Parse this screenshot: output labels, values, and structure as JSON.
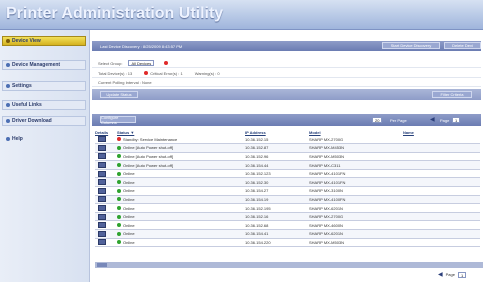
{
  "app": {
    "title": "Printer Administration Utility"
  },
  "sidebar": {
    "items": [
      {
        "label": "Device View",
        "active": true
      },
      {
        "label": "Device Management"
      },
      {
        "label": "Settings"
      },
      {
        "label": "Useful Links"
      },
      {
        "label": "Driver Download"
      },
      {
        "label": "Help"
      }
    ]
  },
  "header": {
    "last_discovery": "Last Device Discovery : 8/25/2009 8:43:57 PM",
    "start_discovery_button": "Start Device Discovery",
    "delete_button": "Delete Devi"
  },
  "group": {
    "label": "Select Group:",
    "value": "All Devices",
    "total_devices": "Total Device(s) : 13",
    "critical_errors": "Critical Error(s) : 1",
    "warnings": "Warning(s) : 0",
    "polling_interval": "Current Polling Interval : None"
  },
  "toolbar": {
    "update_status": "Update Status",
    "filter_criteria": "Filter Criteria",
    "configure_columns": "Configure Columns",
    "per_page_value": "20",
    "per_page_label": "Per Page",
    "page_label": "Page",
    "page_value": "1"
  },
  "table": {
    "headers": {
      "details": "Details",
      "status": "Status ▼",
      "ip": "IP Address",
      "model": "Model",
      "name": "Name"
    },
    "rows": [
      {
        "status": "Standby: Service Maintenance",
        "state": "error",
        "ip": "10.36.152.15",
        "model": "SHARP MX-2700G"
      },
      {
        "status": "Online [Auto Power shut-off]",
        "state": "ok",
        "ip": "10.36.152.87",
        "model": "SHARP MX-M453N"
      },
      {
        "status": "Online [Auto Power shut-off]",
        "state": "ok",
        "ip": "10.36.152.96",
        "model": "SHARP MX-M503N"
      },
      {
        "status": "Online [Auto Power shut-off]",
        "state": "ok",
        "ip": "10.36.154.44",
        "model": "SHARP MX-C311"
      },
      {
        "status": "Online",
        "state": "ok",
        "ip": "10.36.152.123",
        "model": "SHARP MX-4101FN"
      },
      {
        "status": "Online",
        "state": "ok",
        "ip": "10.36.152.30",
        "model": "SHARP MX-4101FN"
      },
      {
        "status": "Online",
        "state": "ok",
        "ip": "10.36.154.27",
        "model": "SHARP MX-3100N"
      },
      {
        "status": "Online",
        "state": "ok",
        "ip": "10.36.154.19",
        "model": "SHARP MX-4100FN"
      },
      {
        "status": "Online",
        "state": "ok",
        "ip": "10.36.152.195",
        "model": "SHARP MX-6201N"
      },
      {
        "status": "Online",
        "state": "ok",
        "ip": "10.36.152.16",
        "model": "SHARP MX-2700G"
      },
      {
        "status": "Online",
        "state": "ok",
        "ip": "10.36.152.68",
        "model": "SHARP MX-4600N"
      },
      {
        "status": "Online",
        "state": "ok",
        "ip": "10.36.154.41",
        "model": "SHARP MX-6201N"
      },
      {
        "status": "Online",
        "state": "ok",
        "ip": "10.36.154.220",
        "model": "SHARP MX-M503N"
      }
    ]
  },
  "footer": {
    "page_label": "Page",
    "page_value": "1"
  }
}
